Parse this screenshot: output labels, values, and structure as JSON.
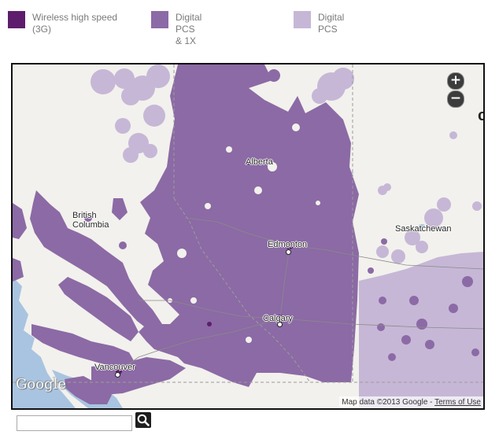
{
  "legend": {
    "items": [
      {
        "label": "Wireless high speed (3G)",
        "color": "#5e1d6c"
      },
      {
        "label": "Digital PCS & 1X",
        "color": "#8c6aa5"
      },
      {
        "label": "Digital PCS",
        "color": "#c6b7d6"
      }
    ]
  },
  "map": {
    "provinces": [
      "British Columbia",
      "Alberta",
      "Saskatchewan"
    ],
    "cities": [
      "Edmonton",
      "Calgary",
      "Vancouver"
    ],
    "zoom": {
      "in_symbol": "+",
      "out_symbol": "−"
    },
    "cropped_control_glyph": "c",
    "logo_text": "Google",
    "attribution_text": "Map data ©2013 Google - ",
    "terms_link": "Terms of Use",
    "colors": {
      "coverage_3g": "#5e1d6c",
      "coverage_pcs_1x": "#8c6aa5",
      "coverage_pcs": "#c6b7d6",
      "land": "#f2f1ed",
      "water": "#a9c4e0"
    }
  },
  "search": {
    "placeholder": "",
    "value": "",
    "icon": "magnifier-icon"
  }
}
